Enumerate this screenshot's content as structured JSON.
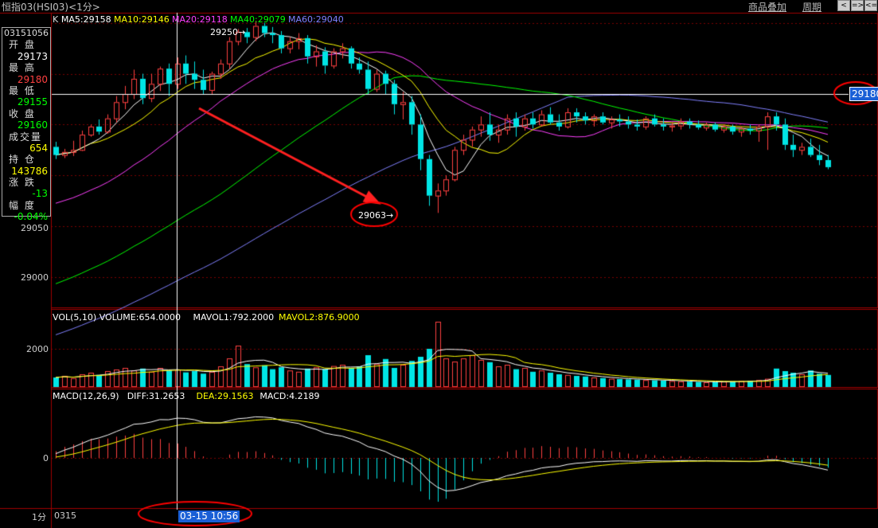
{
  "window": {
    "title": "恒指03(HSI03)<1分>",
    "menu": {
      "overlay": "商品叠加",
      "period": "周期"
    },
    "nav_buttons": [
      "<",
      "=>",
      "<="
    ]
  },
  "info_panel": {
    "code": "03151056",
    "rows": [
      {
        "label": "开 盘",
        "value": "29173",
        "color": "#ffffff"
      },
      {
        "label": "最 高",
        "value": "29180",
        "color": "#ff4040"
      },
      {
        "label": "最 低",
        "value": "29155",
        "color": "#00ff00"
      },
      {
        "label": "收 盘",
        "value": "29160",
        "color": "#00ff00"
      },
      {
        "label": "成交量",
        "value": "654",
        "color": "#ffff00"
      },
      {
        "label": "持 仓",
        "value": "143786",
        "color": "#ffff00"
      },
      {
        "label": "涨 跌",
        "value": "-13",
        "color": "#00ff00"
      },
      {
        "label": "幅 度",
        "value": "-0.04%",
        "color": "#00ff00"
      }
    ]
  },
  "indicators": {
    "price": [
      {
        "text": "K",
        "color": "#dddddd"
      },
      {
        "text": "MA5:29158",
        "color": "#ffffff"
      },
      {
        "text": "MA10:29146",
        "color": "#ffff00"
      },
      {
        "text": "MA20:29118",
        "color": "#ff40ff"
      },
      {
        "text": "MA40:29079",
        "color": "#00ff00"
      },
      {
        "text": "MA60:29040",
        "color": "#8080ff"
      }
    ],
    "volume": [
      {
        "text": "VOL(5,10) VOLUME:654.0000",
        "color": "#ffffff"
      },
      {
        "text": "MAVOL1:792.2000",
        "color": "#ffffff"
      },
      {
        "text": "MAVOL2:876.9000",
        "color": "#ffff00"
      }
    ],
    "macd": [
      {
        "text": "MACD(12,26,9)",
        "color": "#ffffff"
      },
      {
        "text": "DIFF:31.2653",
        "color": "#ffffff"
      },
      {
        "text": "DEA:29.1563",
        "color": "#ffff00"
      },
      {
        "text": "MACD:4.2189",
        "color": "#ffffff"
      }
    ]
  },
  "axes": {
    "price_ticks": [
      "29050",
      "29000"
    ],
    "volume_ticks": [
      "2000"
    ],
    "macd_ticks": [
      "0"
    ],
    "period_label": "1分",
    "x_start_label": "0315"
  },
  "crosshair": {
    "price_label": "29180",
    "time_label": "03-15 10:56"
  },
  "annotations": {
    "high_label": "29250",
    "low_label": "29063"
  },
  "colors": {
    "up": "#ff4040",
    "down": "#00e5e5",
    "grid": "#7a0000",
    "ma5": "#ffffff",
    "ma10": "#ffff00",
    "ma20": "#ff40ff",
    "ma40": "#00ff00",
    "ma60": "#8080ff",
    "arrow": "#ff2020",
    "highlight_circle": "#ff0000"
  },
  "chart_data": {
    "type": "candlestick",
    "symbol": "恒指03(HSI03)",
    "period": "1分",
    "ylim": [
      28970,
      29260
    ],
    "marked_high": 29250,
    "marked_low": 29063,
    "candles": [
      [
        29128,
        29133,
        29116,
        29120
      ],
      [
        29120,
        29126,
        29117,
        29123
      ],
      [
        29123,
        29134,
        29119,
        29125
      ],
      [
        29125,
        29144,
        29124,
        29140
      ],
      [
        29140,
        29150,
        29138,
        29148
      ],
      [
        29148,
        29155,
        29140,
        29143
      ],
      [
        29143,
        29160,
        29141,
        29156
      ],
      [
        29156,
        29178,
        29152,
        29172
      ],
      [
        29172,
        29188,
        29165,
        29180
      ],
      [
        29180,
        29204,
        29175,
        29195
      ],
      [
        29195,
        29200,
        29170,
        29176
      ],
      [
        29176,
        29200,
        29172,
        29190
      ],
      [
        29190,
        29207,
        29183,
        29205
      ],
      [
        29205,
        29210,
        29178,
        29190
      ],
      [
        29190,
        29216,
        29185,
        29210
      ],
      [
        29210,
        29218,
        29190,
        29200
      ],
      [
        29200,
        29212,
        29185,
        29194
      ],
      [
        29194,
        29204,
        29180,
        29184
      ],
      [
        29184,
        29202,
        29180,
        29200
      ],
      [
        29200,
        29214,
        29195,
        29210
      ],
      [
        29210,
        29236,
        29205,
        29232
      ],
      [
        29232,
        29244,
        29228,
        29241
      ],
      [
        29241,
        29245,
        29230,
        29236
      ],
      [
        29236,
        29252,
        29232,
        29247
      ],
      [
        29247,
        29250,
        29236,
        29240
      ],
      [
        29240,
        29246,
        29230,
        29238
      ],
      [
        29238,
        29242,
        29220,
        29225
      ],
      [
        29225,
        29236,
        29220,
        29232
      ],
      [
        29232,
        29240,
        29224,
        29235
      ],
      [
        29235,
        29238,
        29210,
        29217
      ],
      [
        29217,
        29228,
        29207,
        29222
      ],
      [
        29222,
        29226,
        29200,
        29208
      ],
      [
        29208,
        29225,
        29205,
        29222
      ],
      [
        29222,
        29230,
        29215,
        29225
      ],
      [
        29225,
        29227,
        29205,
        29210
      ],
      [
        29210,
        29216,
        29200,
        29204
      ],
      [
        29204,
        29212,
        29180,
        29185
      ],
      [
        29185,
        29204,
        29182,
        29200
      ],
      [
        29200,
        29203,
        29180,
        29190
      ],
      [
        29190,
        29194,
        29160,
        29170
      ],
      [
        29170,
        29182,
        29155,
        29172
      ],
      [
        29172,
        29178,
        29140,
        29150
      ],
      [
        29150,
        29160,
        29105,
        29116
      ],
      [
        29116,
        29120,
        29070,
        29080
      ],
      [
        29080,
        29092,
        29063,
        29085
      ],
      [
        29085,
        29100,
        29080,
        29096
      ],
      [
        29096,
        29128,
        29094,
        29125
      ],
      [
        29125,
        29140,
        29120,
        29135
      ],
      [
        29135,
        29148,
        29128,
        29145
      ],
      [
        29145,
        29158,
        29138,
        29150
      ],
      [
        29150,
        29162,
        29134,
        29140
      ],
      [
        29140,
        29150,
        29132,
        29145
      ],
      [
        29145,
        29160,
        29140,
        29156
      ],
      [
        29156,
        29162,
        29138,
        29148
      ],
      [
        29148,
        29160,
        29144,
        29156
      ],
      [
        29156,
        29162,
        29146,
        29150
      ],
      [
        29150,
        29164,
        29148,
        29160
      ],
      [
        29160,
        29167,
        29150,
        29152
      ],
      [
        29152,
        29160,
        29144,
        29148
      ],
      [
        29148,
        29166,
        29146,
        29162
      ],
      [
        29162,
        29166,
        29152,
        29158
      ],
      [
        29158,
        29162,
        29150,
        29154
      ],
      [
        29154,
        29160,
        29148,
        29158
      ],
      [
        29158,
        29162,
        29150,
        29152
      ],
      [
        29152,
        29158,
        29146,
        29155
      ],
      [
        29155,
        29160,
        29148,
        29153
      ],
      [
        29153,
        29158,
        29146,
        29150
      ],
      [
        29150,
        29155,
        29144,
        29148
      ],
      [
        29148,
        29158,
        29145,
        29156
      ],
      [
        29156,
        29160,
        29148,
        29150
      ],
      [
        29150,
        29156,
        29144,
        29148
      ],
      [
        29148,
        29152,
        29143,
        29149
      ],
      [
        29149,
        29156,
        29145,
        29153
      ],
      [
        29153,
        29156,
        29146,
        29150
      ],
      [
        29150,
        29154,
        29145,
        29147
      ],
      [
        29147,
        29152,
        29144,
        29150
      ],
      [
        29150,
        29152,
        29143,
        29145
      ],
      [
        29145,
        29150,
        29142,
        29148
      ],
      [
        29148,
        29150,
        29140,
        29143
      ],
      [
        29143,
        29148,
        29138,
        29146
      ],
      [
        29146,
        29150,
        29140,
        29144
      ],
      [
        29144,
        29150,
        29133,
        29148
      ],
      [
        29148,
        29162,
        29125,
        29158
      ],
      [
        29158,
        29162,
        29144,
        29150
      ],
      [
        29150,
        29156,
        29125,
        29130
      ],
      [
        29130,
        29140,
        29118,
        29125
      ],
      [
        29125,
        29132,
        29120,
        29128
      ],
      [
        29128,
        29136,
        29118,
        29120
      ],
      [
        29120,
        29130,
        29110,
        29115
      ],
      [
        29115,
        29120,
        29106,
        29108
      ]
    ],
    "volume": [
      300,
      350,
      280,
      400,
      450,
      380,
      500,
      550,
      600,
      520,
      580,
      480,
      600,
      520,
      550,
      460,
      500,
      420,
      480,
      650,
      900,
      1300,
      720,
      620,
      680,
      560,
      620,
      520,
      480,
      580,
      620,
      560,
      660,
      700,
      600,
      650,
      1000,
      720,
      880,
      600,
      700,
      820,
      950,
      1200,
      2050,
      900,
      800,
      900,
      1000,
      850,
      780,
      650,
      700,
      560,
      600,
      480,
      520,
      450,
      400,
      380,
      350,
      330,
      300,
      280,
      260,
      250,
      240,
      230,
      220,
      210,
      200,
      190,
      180,
      170,
      160,
      150,
      160,
      170,
      180,
      190,
      200,
      220,
      260,
      580,
      500,
      450,
      400,
      520,
      420,
      380
    ],
    "mavol1": 792.2,
    "mavol2": 876.9
  }
}
